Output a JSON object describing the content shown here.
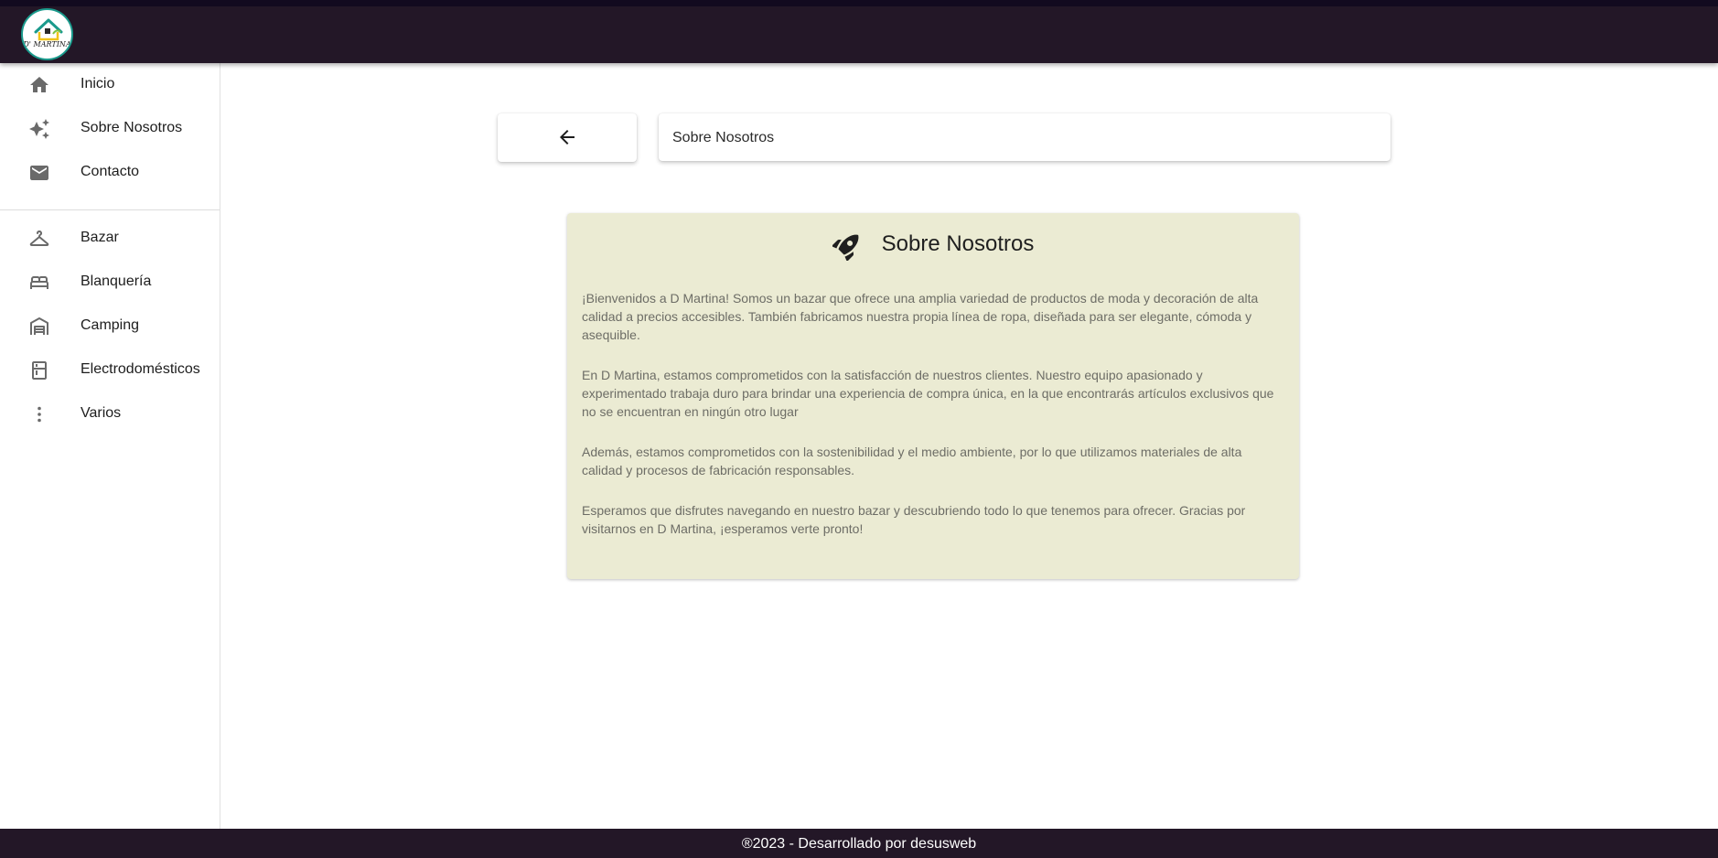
{
  "brand": {
    "logo_text": "D' MARTINA",
    "bar_color": "#231727",
    "accent": "#1a9a8c"
  },
  "sidebar": {
    "items": [
      {
        "label": "Inicio",
        "icon": "home-icon"
      },
      {
        "label": "Sobre Nosotros",
        "icon": "sparkles-icon"
      },
      {
        "label": "Contacto",
        "icon": "mail-icon"
      },
      {
        "label": "Bazar",
        "icon": "hanger-icon"
      },
      {
        "label": "Blanquería",
        "icon": "bed-icon"
      },
      {
        "label": "Camping",
        "icon": "warehouse-icon"
      },
      {
        "label": "Electrodomésticos",
        "icon": "fridge-icon"
      },
      {
        "label": "Varios",
        "icon": "more-vertical-icon"
      }
    ]
  },
  "header": {
    "back_icon": "arrow-left-icon",
    "page_title": "Sobre Nosotros"
  },
  "card": {
    "icon": "rocket-icon",
    "title": "Sobre Nosotros",
    "background": "#ebebd3",
    "paragraphs": [
      "¡Bienvenidos a D Martina! Somos un bazar que ofrece una amplia variedad de productos de moda y decoración de alta calidad a precios accesibles. También fabricamos nuestra propia línea de ropa, diseñada para ser elegante, cómoda y asequible.",
      "En D Martina, estamos comprometidos con la satisfacción de nuestros clientes. Nuestro equipo apasionado y experimentado trabaja duro para brindar una experiencia de compra única, en la que encontrarás artículos exclusivos que no se encuentran en ningún otro lugar",
      "Además, estamos comprometidos con la sostenibilidad y el medio ambiente, por lo que utilizamos materiales de alta calidad y procesos de fabricación responsables.",
      "Esperamos que disfrutes navegando en nuestro bazar y descubriendo todo lo que tenemos para ofrecer. Gracias por visitarnos en D Martina, ¡esperamos verte pronto!"
    ]
  },
  "footer": {
    "text": "®2023 - Desarrollado por desusweb"
  }
}
